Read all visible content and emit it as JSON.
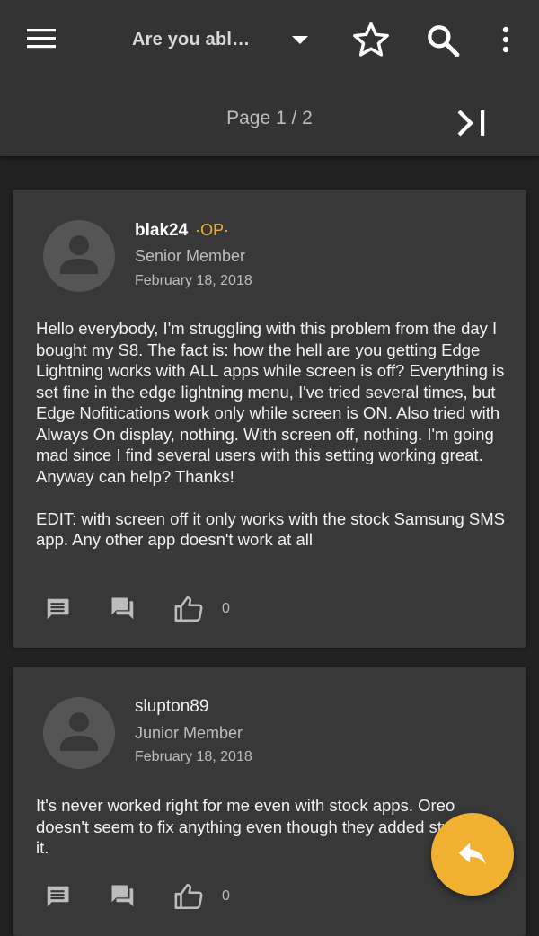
{
  "appbar": {
    "title": "Are you abl…",
    "page_info": "Page 1 / 2",
    "icons": [
      "menu-icon",
      "dropdown-icon",
      "star-icon",
      "search-icon",
      "more-vert-icon",
      "last-page-icon"
    ]
  },
  "posts": [
    {
      "username": "blak24",
      "op_badge": "·OP·",
      "role": "Senior Member",
      "date": "February 18, 2018",
      "body": "Hello everybody, I'm struggling with this problem from the day I bought my S8. The fact is: how the hell are you getting Edge Lightning works with ALL apps while screen is off? Everything is set fine in the edge lightning menu, I've tried several times, but Edge Nofitications work only while screen is ON. Also tried with Always On display, nothing. With screen off, nothing. I'm going mad since I find several users with this setting working great. Anyway can help? Thanks!\n\nEDIT: with screen off it only works with the stock Samsung SMS app. Any other app doesn't work at all",
      "likes": "0"
    },
    {
      "username": "slupton89",
      "role": "Junior Member",
      "date": "February 18, 2018",
      "body": "It's never worked right for me even with stock apps. Oreo doesn't seem to fix anything even though they added styles for it.",
      "likes": "0"
    }
  ],
  "colors": {
    "accent": "#f0b030",
    "background": "#222222",
    "card": "#383838",
    "appbar": "#333333"
  }
}
